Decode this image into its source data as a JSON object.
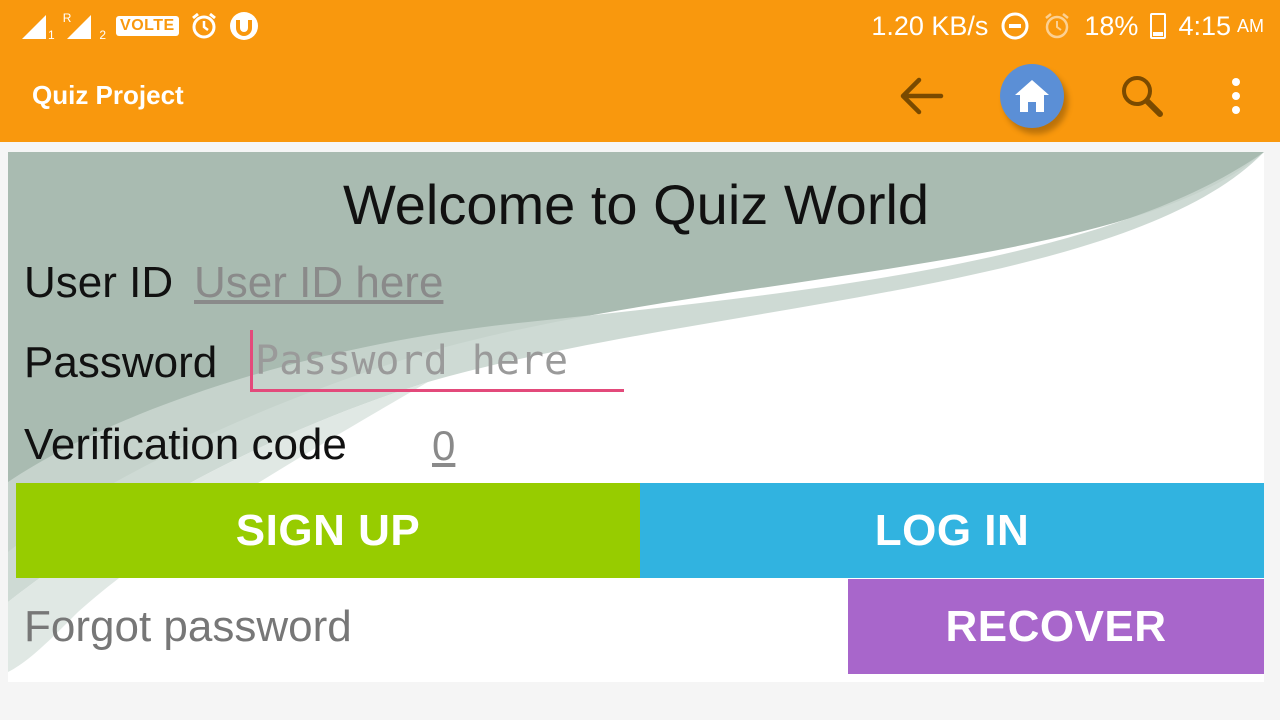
{
  "status_bar": {
    "sim1_label": "1",
    "sim2_label": "2",
    "roaming_label": "R",
    "volte_label": "VOLTE",
    "speed": "1.20 KB/s",
    "battery": "18%",
    "time": "4:15",
    "ampm": "AM",
    "icons": [
      "signal-icon",
      "signal-roaming-icon",
      "volte-icon",
      "alarm-icon",
      "utorrent-icon",
      "data-saver-icon",
      "alarm-icon",
      "battery-icon"
    ]
  },
  "app_bar": {
    "title": "Quiz Project",
    "actions": [
      "back-arrow-icon",
      "home-icon",
      "search-icon",
      "overflow-menu-icon"
    ]
  },
  "form": {
    "heading": "Welcome to Quiz World",
    "user_id_label": "User ID",
    "user_id_placeholder": "User ID here",
    "password_label": "Password",
    "password_placeholder": "Password here",
    "verification_label": "Verification code",
    "verification_value": "0"
  },
  "buttons": {
    "signup": "SIGN UP",
    "login": "LOG IN",
    "recover": "RECOVER"
  },
  "forgot_label": "Forgot password",
  "colors": {
    "accent": "#f9980d",
    "signup": "#97cc00",
    "login": "#31b3e0",
    "recover": "#a866cb",
    "home_button": "#5b8fd6",
    "cursor": "#e34a7b"
  }
}
